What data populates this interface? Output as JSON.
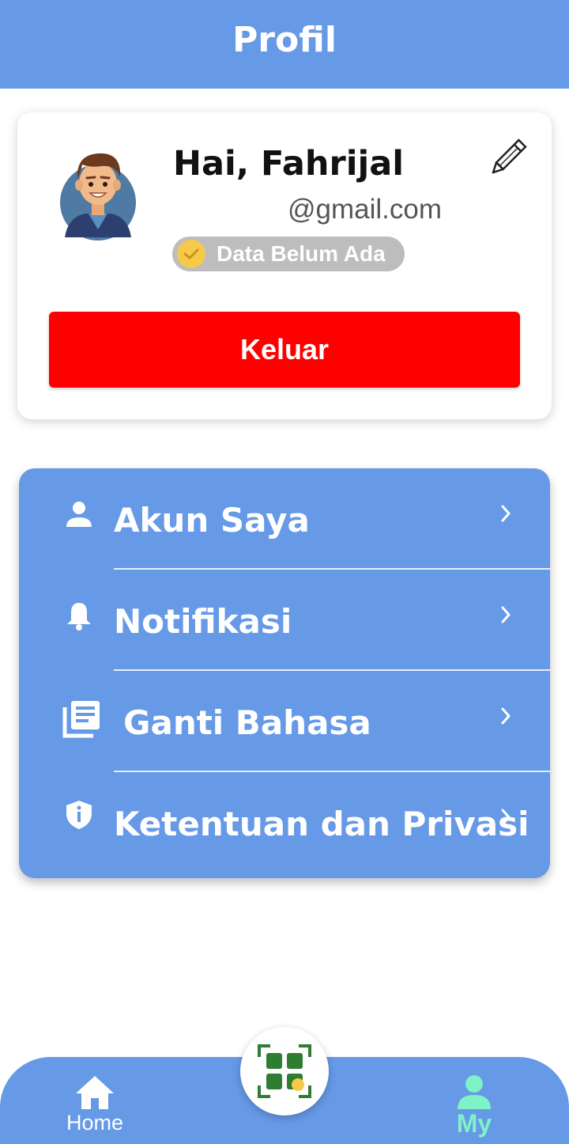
{
  "header": {
    "title": "Profil"
  },
  "profile": {
    "greeting": "Hai, Fahrijal",
    "email": "@gmail.com",
    "status_badge": "Data Belum Ada",
    "logout_label": "Keluar"
  },
  "menu": {
    "items": [
      {
        "label": "Akun Saya",
        "icon": "person-icon"
      },
      {
        "label": "Notifikasi",
        "icon": "bell-icon"
      },
      {
        "label": "Ganti Bahasa",
        "icon": "library-books-icon"
      },
      {
        "label": "Ketentuan dan Privasi",
        "icon": "shield-info-icon"
      }
    ]
  },
  "bottom_nav": {
    "home_label": "Home",
    "my_label": "My",
    "scan_icon": "qr-scan-icon"
  },
  "colors": {
    "primary": "#6699e6",
    "danger": "#ff0000",
    "active_nav": "#7ff2c8",
    "badge_bg": "#bdbdbd"
  }
}
